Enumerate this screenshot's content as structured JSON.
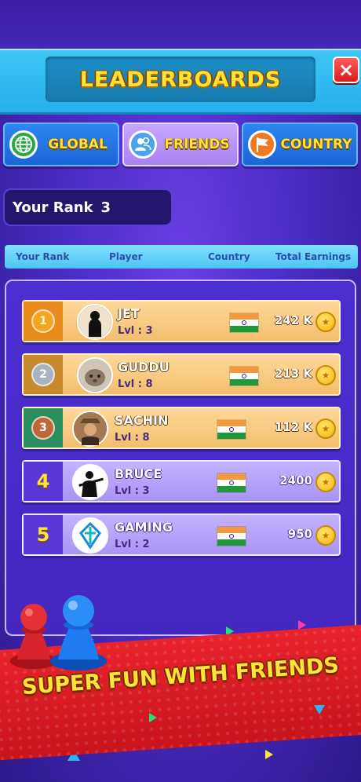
{
  "header": {
    "title": "LEADERBOARDS",
    "close_label": "×"
  },
  "tabs": [
    {
      "label": "GLOBAL",
      "icon": "globe-icon",
      "selected": false
    },
    {
      "label": "FRIENDS",
      "icon": "friends-icon",
      "selected": true
    },
    {
      "label": "COUNTRY",
      "icon": "flag-icon",
      "selected": false
    }
  ],
  "your_rank": {
    "label": "Your Rank",
    "value": "3"
  },
  "columns": [
    "Your Rank",
    "Player",
    "Country",
    "Total Earnings"
  ],
  "rows": [
    {
      "rank": "1",
      "name": "JET",
      "level": "Lvl : 3",
      "earnings": "242 K",
      "country": "India"
    },
    {
      "rank": "2",
      "name": "GUDDU",
      "level": "Lvl : 8",
      "earnings": "213 K",
      "country": "India"
    },
    {
      "rank": "3",
      "name": "SACHIN",
      "level": "Lvl : 8",
      "earnings": "112 K",
      "country": "India"
    },
    {
      "rank": "4",
      "name": "BRUCE",
      "level": "Lvl : 3",
      "earnings": "2400",
      "country": "India"
    },
    {
      "rank": "5",
      "name": "GAMING",
      "level": "Lvl : 2",
      "earnings": "950",
      "country": "India"
    }
  ],
  "banner": {
    "text": "SUPER FUN WITH FRIENDS"
  },
  "colors": {
    "accent_yellow": "#ffe23a",
    "header_blue": "#26b0ea",
    "panel_purple": "#4427c0",
    "gold_row": "#f3be6d",
    "lavender_row": "#a993f5",
    "banner_red": "#e8232c"
  }
}
